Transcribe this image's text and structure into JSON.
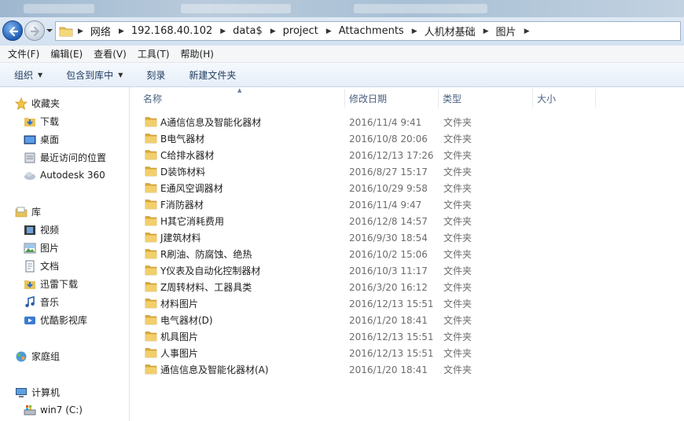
{
  "address": {
    "crumbs": [
      "网络",
      "192.168.40.102",
      "data$",
      "project",
      "Attachments",
      "人机材基础",
      "图片"
    ]
  },
  "menu": [
    "文件(F)",
    "编辑(E)",
    "查看(V)",
    "工具(T)",
    "帮助(H)"
  ],
  "commands": {
    "organize": "组织",
    "include_library": "包含到库中",
    "burn": "刻录",
    "new_folder": "新建文件夹"
  },
  "nav": {
    "favorites": {
      "label": "收藏夹",
      "items": [
        "下载",
        "桌面",
        "最近访问的位置",
        "Autodesk 360"
      ]
    },
    "libraries": {
      "label": "库",
      "items": [
        "视频",
        "图片",
        "文档",
        "迅雷下载",
        "音乐",
        "优酷影视库"
      ]
    },
    "homegroup": "家庭组",
    "computer": {
      "label": "计算机",
      "items": [
        "win7 (C:)"
      ]
    }
  },
  "columns": {
    "name": "名称",
    "date": "修改日期",
    "type": "类型",
    "size": "大小"
  },
  "files": [
    {
      "name": "A通信信息及智能化器材",
      "date": "2016/11/4 9:41",
      "type": "文件夹"
    },
    {
      "name": "B电气器材",
      "date": "2016/10/8 20:06",
      "type": "文件夹"
    },
    {
      "name": "C给排水器材",
      "date": "2016/12/13 17:26",
      "type": "文件夹"
    },
    {
      "name": "D装饰材料",
      "date": "2016/8/27 15:17",
      "type": "文件夹"
    },
    {
      "name": "E通风空调器材",
      "date": "2016/10/29 9:58",
      "type": "文件夹"
    },
    {
      "name": "F消防器材",
      "date": "2016/11/4 9:47",
      "type": "文件夹"
    },
    {
      "name": "H其它消耗费用",
      "date": "2016/12/8 14:57",
      "type": "文件夹"
    },
    {
      "name": "J建筑材料",
      "date": "2016/9/30 18:54",
      "type": "文件夹"
    },
    {
      "name": "R刷油、防腐蚀、绝热",
      "date": "2016/10/2 15:06",
      "type": "文件夹"
    },
    {
      "name": "Y仪表及自动化控制器材",
      "date": "2016/10/3 11:17",
      "type": "文件夹"
    },
    {
      "name": "Z周转材料、工器具类",
      "date": "2016/3/20 16:12",
      "type": "文件夹"
    },
    {
      "name": "材料图片",
      "date": "2016/12/13 15:51",
      "type": "文件夹"
    },
    {
      "name": "电气器材(D)",
      "date": "2016/1/20 18:41",
      "type": "文件夹"
    },
    {
      "name": "机具图片",
      "date": "2016/12/13 15:51",
      "type": "文件夹"
    },
    {
      "name": "人事图片",
      "date": "2016/12/13 15:51",
      "type": "文件夹"
    },
    {
      "name": "通信信息及智能化器材(A)",
      "date": "2016/1/20 18:41",
      "type": "文件夹"
    }
  ]
}
